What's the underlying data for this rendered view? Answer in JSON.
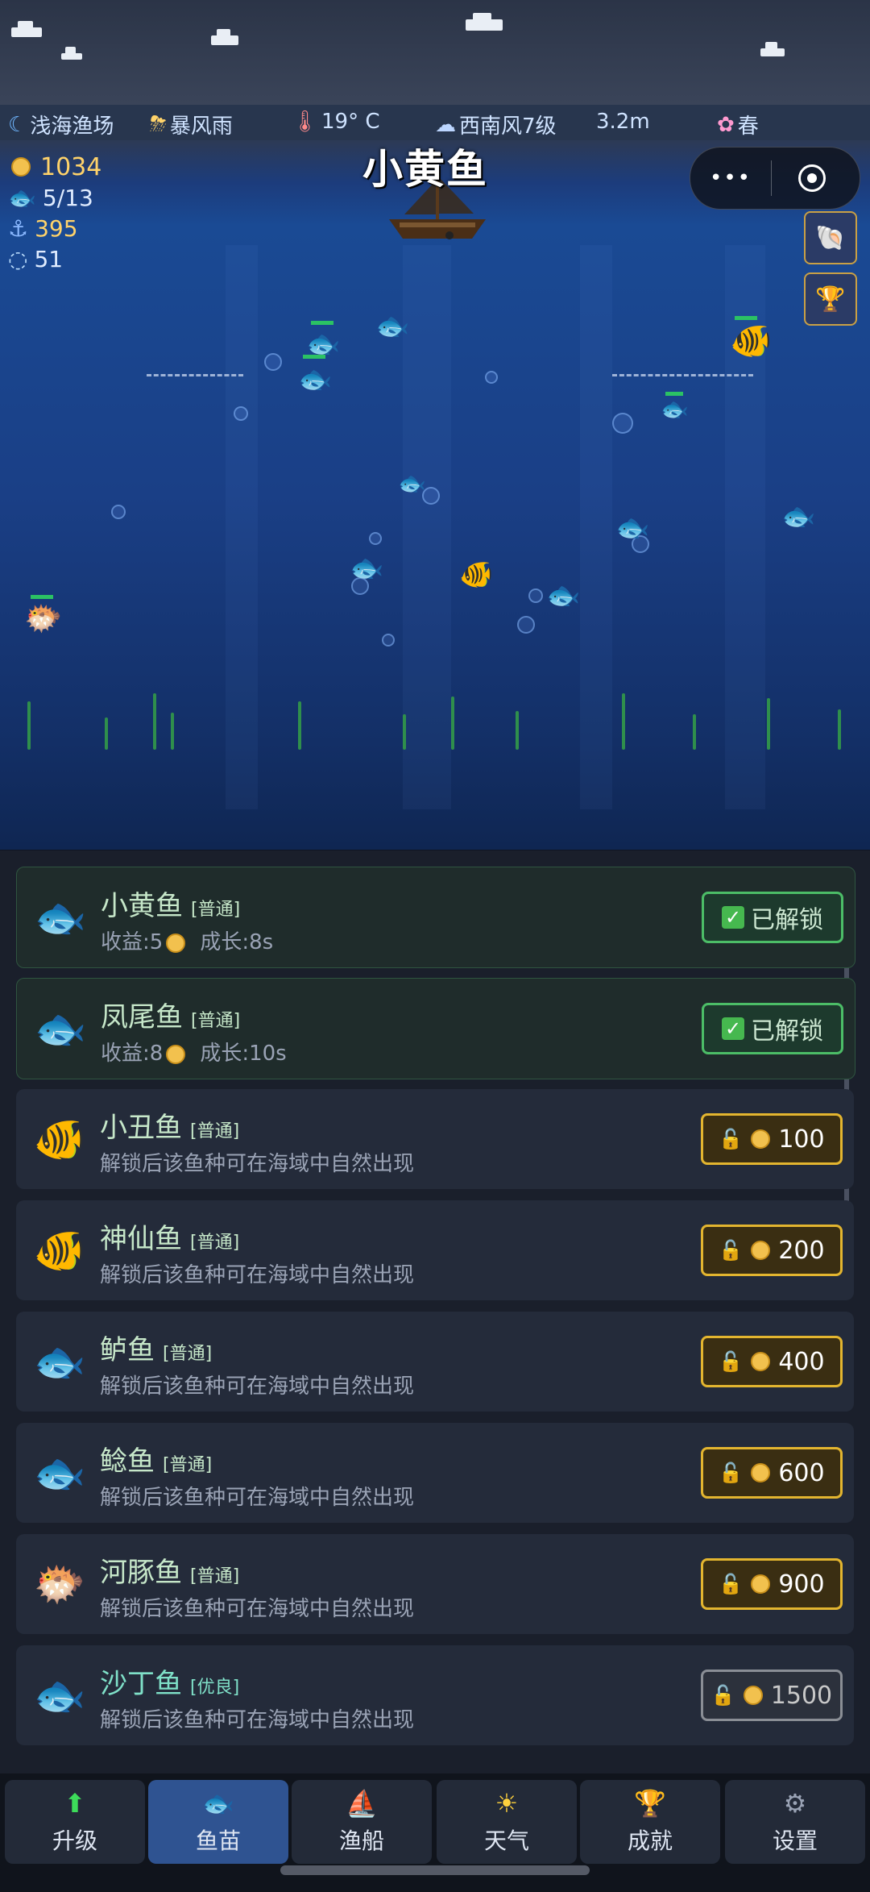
{
  "status": {
    "location": "浅海渔场",
    "weather": "暴风雨",
    "temperature": "19° C",
    "wind": "西南风7级",
    "depth": "3.2m",
    "season": "春"
  },
  "hud": {
    "coins": "1034",
    "fish_count": "5/13",
    "hooks": "395",
    "bubbles": "51",
    "banner": "小黄鱼",
    "mini_program_more": "•••"
  },
  "fish_list": [
    {
      "name": "小黄鱼",
      "rarity": "[普通]",
      "income_label": "收益:5",
      "growth_label": "成长:8s",
      "status": "已解锁",
      "icon": "yellow-fish-icon",
      "glyph": "🐟"
    },
    {
      "name": "凤尾鱼",
      "rarity": "[普通]",
      "income_label": "收益:8",
      "growth_label": "成长:10s",
      "status": "已解锁",
      "icon": "anchovy-icon",
      "glyph": "🐟"
    },
    {
      "name": "小丑鱼",
      "rarity": "[普通]",
      "desc": "解锁后该鱼种可在海域中自然出现",
      "price": "100",
      "icon": "clownfish-icon",
      "glyph": "🐠"
    },
    {
      "name": "神仙鱼",
      "rarity": "[普通]",
      "desc": "解锁后该鱼种可在海域中自然出现",
      "price": "200",
      "icon": "angelfish-icon",
      "glyph": "🐠"
    },
    {
      "name": "鲈鱼",
      "rarity": "[普通]",
      "desc": "解锁后该鱼种可在海域中自然出现",
      "price": "400",
      "icon": "bass-icon",
      "glyph": "🐟"
    },
    {
      "name": "鲶鱼",
      "rarity": "[普通]",
      "desc": "解锁后该鱼种可在海域中自然出现",
      "price": "600",
      "icon": "catfish-icon",
      "glyph": "🐟"
    },
    {
      "name": "河豚鱼",
      "rarity": "[普通]",
      "desc": "解锁后该鱼种可在海域中自然出现",
      "price": "900",
      "icon": "pufferfish-icon",
      "glyph": "🐡"
    },
    {
      "name": "沙丁鱼",
      "rarity": "[优良]",
      "desc": "解锁后该鱼种可在海域中自然出现",
      "price": "1500",
      "icon": "sardine-icon",
      "glyph": "🐟"
    }
  ],
  "tabs": [
    {
      "label": "升级",
      "icon": "upgrade-arrow-icon",
      "glyph": "⬆"
    },
    {
      "label": "鱼苗",
      "icon": "fish-fry-icon",
      "glyph": "🐟"
    },
    {
      "label": "渔船",
      "icon": "boat-icon",
      "glyph": "⛵"
    },
    {
      "label": "天气",
      "icon": "sun-icon",
      "glyph": "☀"
    },
    {
      "label": "成就",
      "icon": "trophy-icon",
      "glyph": "🏆"
    },
    {
      "label": "设置",
      "icon": "gear-icon",
      "glyph": "⚙"
    }
  ],
  "active_tab": 1
}
